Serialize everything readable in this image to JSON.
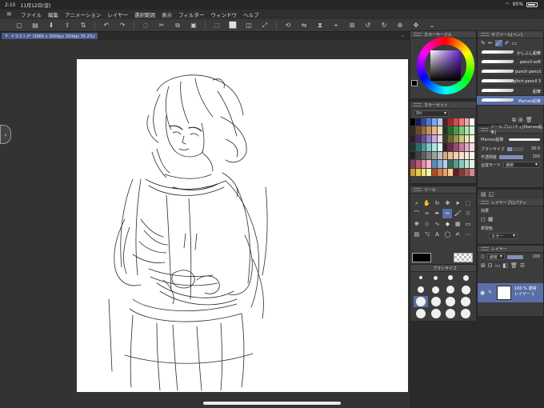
{
  "status": {
    "time": "2:15",
    "date": "11月12日(金)",
    "battery": "95%"
  },
  "menu": {
    "items": [
      "ファイル",
      "編集",
      "アニメーション",
      "レイヤー",
      "選択範囲",
      "表示",
      "フィルター",
      "ウィンドウ",
      "ヘルプ"
    ]
  },
  "tab": {
    "close": "×",
    "title": "イラスト2* (3060 x 3000px 350dpi 35.2%)"
  },
  "color_wheel": {
    "title": "カラーサークル",
    "selected_color": "#6b1fd8"
  },
  "color_set": {
    "title": "カラーセット",
    "set_name": "Shi"
  },
  "sub_tool": {
    "title": "サブツール[ペン]",
    "brushes": [
      {
        "name": "かしふし鉛筆",
        "selected": false
      },
      {
        "name": "pencil-soft",
        "selected": false
      },
      {
        "name": "punch pencil",
        "selected": false
      },
      {
        "name": "glitch pencil 3",
        "selected": false
      },
      {
        "name": "鉛筆",
        "selected": false
      },
      {
        "name": "Mameo鉛筆",
        "selected": true
      }
    ]
  },
  "tool_property": {
    "title": "ツールプロパティ[Mameo鉛筆]",
    "brush_name": "Mameo鉛筆",
    "brush_size_label": "ブラシサイズ",
    "brush_size": "30.0",
    "brush_size_fraction": 0.3,
    "opacity_label": "不透明度",
    "opacity": "100",
    "opacity_fraction": 1.0,
    "blend_label": "合成モード",
    "blend_value": "通常"
  },
  "tool_panel": {
    "title": "ツール"
  },
  "brush_size_panel": {
    "title": "ブラシサイズ",
    "sizes": [
      "2",
      "3",
      "5",
      "7",
      "10",
      "15",
      "20",
      "25",
      "30",
      "40",
      "50",
      "60",
      "70",
      "80",
      "100",
      "150"
    ],
    "selected": "30"
  },
  "layer_property": {
    "title": "レイヤープロパティ",
    "effect_label": "効果",
    "color_label": "表現色",
    "color_value": "カラー"
  },
  "layer_panel": {
    "title": "レイヤー",
    "blend": "通常",
    "opacity": "100",
    "layer": {
      "opacity_label": "100 %",
      "blend": "通常",
      "name": "レイヤー 1"
    }
  },
  "swatch_colors": [
    "#000000",
    "#1a1a5a",
    "#2a4aa0",
    "#4a7ad8",
    "#7aa8f0",
    "#a8c8f8",
    "#5a1a1a",
    "#a02a2a",
    "#d84a4a",
    "#f07a7a",
    "#f8a8a8",
    "#ffffff",
    "#3a2a1a",
    "#6a4a2a",
    "#9a6a3a",
    "#c8905a",
    "#e8b888",
    "#f8dcc0",
    "#1a3a1a",
    "#2a6a2a",
    "#4a9a4a",
    "#7ac87a",
    "#a8e8a8",
    "#d8f8d8",
    "#2a1a3a",
    "#4a2a6a",
    "#6a4a9a",
    "#9a7ac8",
    "#c8a8e8",
    "#e8d8f8",
    "#3a3a1a",
    "#6a6a2a",
    "#9a9a4a",
    "#c8c87a",
    "#e8e8a8",
    "#f8f8d8",
    "#1a3a3a",
    "#2a6a6a",
    "#4a9a9a",
    "#7ac8c8",
    "#a8e8e8",
    "#d8f8f8",
    "#3a1a2a",
    "#6a2a4a",
    "#9a4a6a",
    "#c87a9a",
    "#e8a8c8",
    "#f8d8e8",
    "#202020",
    "#404040",
    "#606060",
    "#808080",
    "#a0a0a0",
    "#c0c0c0",
    "#d8a878",
    "#e8c098",
    "#f0d0b0",
    "#f8e0c8",
    "#fcecd8",
    "#fff4ea",
    "#8a3a5a",
    "#b85a7a",
    "#e88aa8",
    "#f8b8c8",
    "#5a8ab8",
    "#88b0d8",
    "#b8d0e8",
    "#3a6a5a",
    "#5a9a8a",
    "#8ac8b8",
    "#b8e8d8",
    "#e0f4ec",
    "#c8a028",
    "#e8c848",
    "#f8e078",
    "#f8f0a8",
    "#a85020",
    "#d87840",
    "#f0a068",
    "#f8c898",
    "#602020",
    "#883838",
    "#b05858",
    "#d88888"
  ]
}
